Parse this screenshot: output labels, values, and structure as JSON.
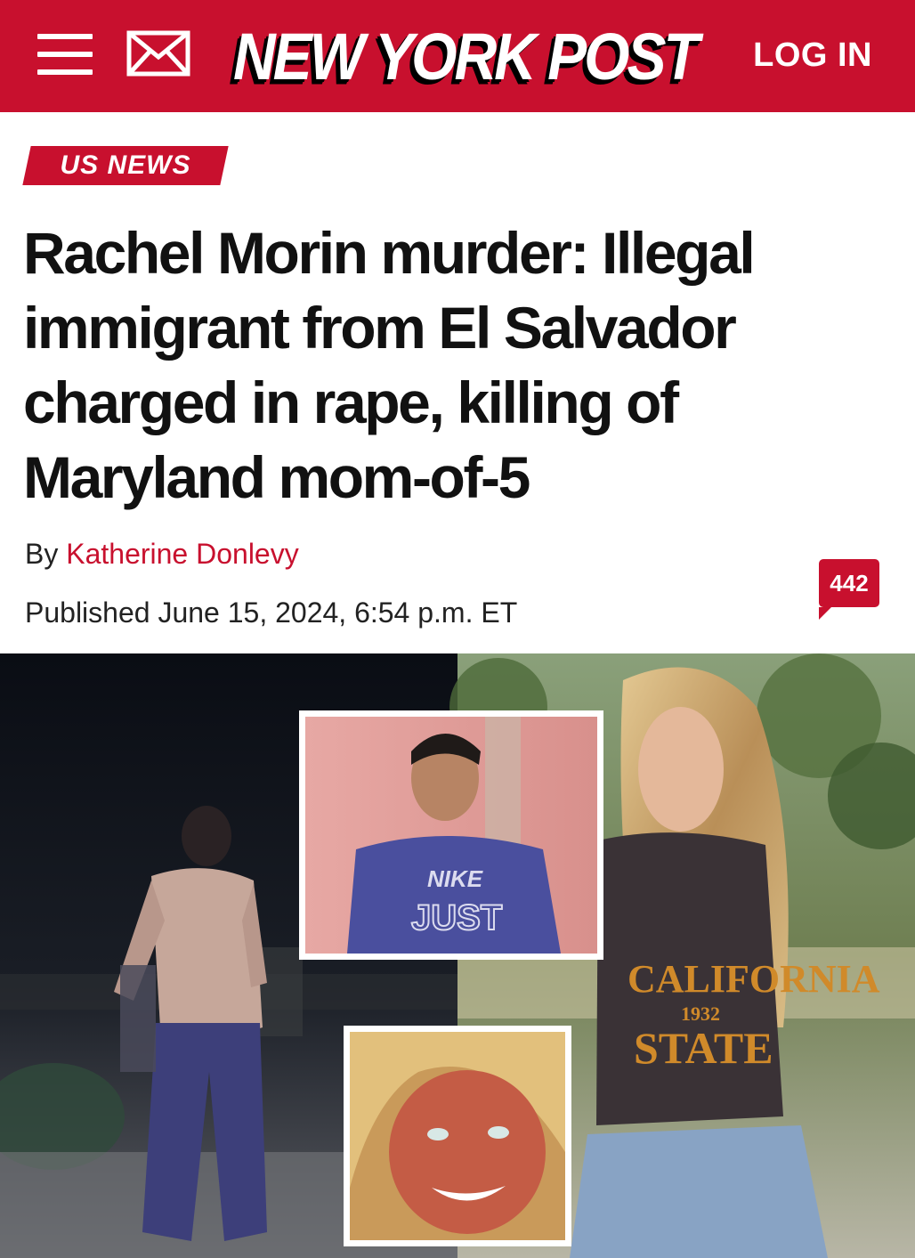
{
  "header": {
    "brand": "NEW YORK POST",
    "login_label": "LOG IN",
    "menu_icon": "hamburger-menu-icon",
    "mail_icon": "envelope-icon",
    "brand_color": "#c8102e"
  },
  "article": {
    "section": "US NEWS",
    "headline": "Rachel Morin murder: Illegal immigrant from El Salvador charged in rape, killing of Maryland mom-of-5",
    "byline_prefix": "By",
    "author": "Katherine Donlevy",
    "published": "Published June 15, 2024, 6:54 p.m. ET",
    "comment_count": "442"
  },
  "photo": {
    "shirt_text_left": "NIKE",
    "shirt_text_left_2": "JUST",
    "shirt_text_right_1": "CALIFORNIA",
    "shirt_text_right_2": "1932",
    "shirt_text_right_3": "STATE"
  }
}
